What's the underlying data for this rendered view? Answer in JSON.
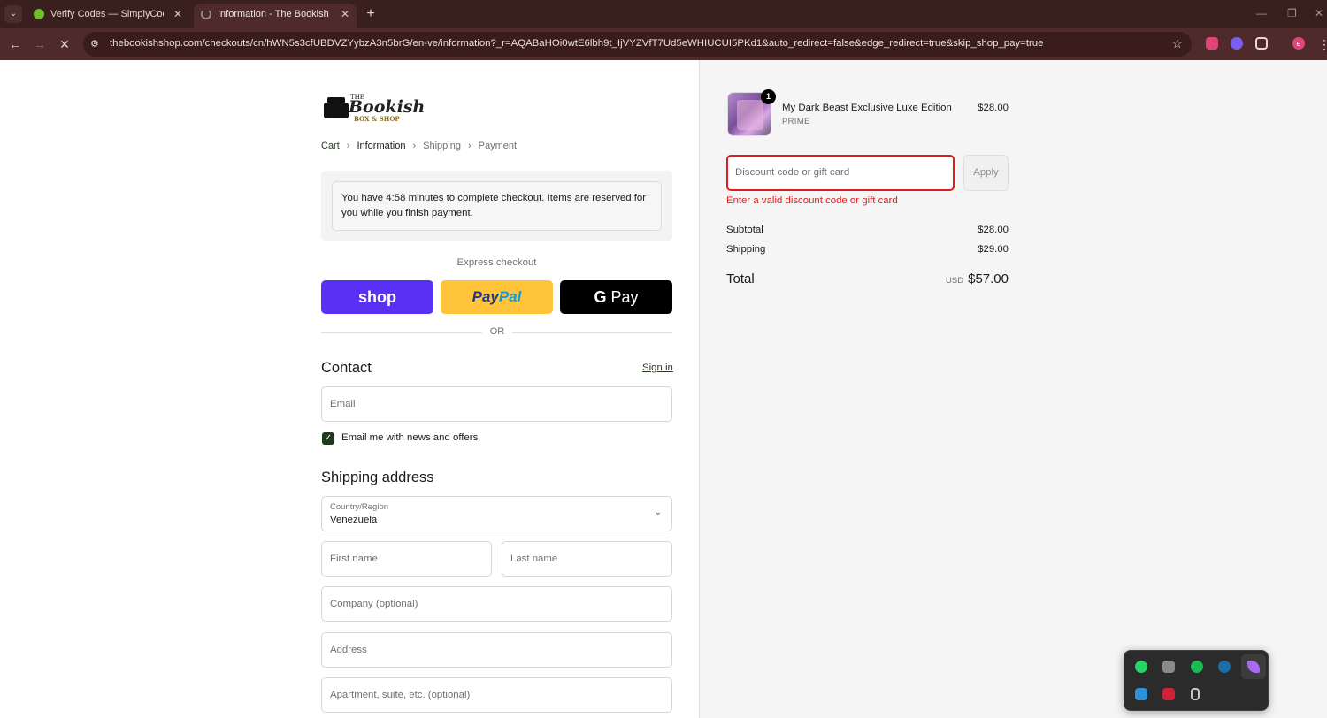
{
  "browser": {
    "tabs": [
      {
        "title": "Verify Codes — SimplyCodes",
        "active": false,
        "favicon_color": "#6fbf2a"
      },
      {
        "title": "Information - The Bookish Shop",
        "active": true,
        "favicon_color": "#9a8a8a"
      }
    ],
    "url": "thebookishshop.com/checkouts/cn/hWN5s3cfUBDVZYybzA3n5brG/en-ve/information?_r=AQABaHOi0wtE6lbh9t_IjVYZVfT7Ud5eWHIUCUI5PKd1&auto_redirect=false&edge_redirect=true&skip_shop_pay=true",
    "extensions": [
      {
        "name": "shield-extension-icon",
        "color": "#e0457a"
      },
      {
        "name": "purple-extension-icon",
        "color": "#7b5cf5"
      },
      {
        "name": "puzzle-extension-icon",
        "color": "#4e2a2a"
      },
      {
        "name": "profile-avatar",
        "color": "#e0457a",
        "letter": "e"
      }
    ]
  },
  "logo": {
    "the": "THE",
    "word": "Bookish",
    "sub": "BOX & SHOP"
  },
  "breadcrumb": {
    "cart": "Cart",
    "information": "Information",
    "shipping": "Shipping",
    "payment": "Payment"
  },
  "timer_notice": "You have 4:58 minutes to complete checkout. Items are reserved for you while you finish payment.",
  "express": {
    "label": "Express checkout",
    "shop": "shop",
    "paypal_a": "Pay",
    "paypal_b": "Pal",
    "gpay_g": "G",
    "gpay_text": "Pay"
  },
  "or_text": "OR",
  "contact": {
    "heading": "Contact",
    "sign_in": "Sign in",
    "email_placeholder": "Email",
    "newsletter_label": "Email me with news and offers",
    "newsletter_checked": true
  },
  "shipping": {
    "heading": "Shipping address",
    "country_label": "Country/Region",
    "country_value": "Venezuela",
    "first_name": "First name",
    "last_name": "Last name",
    "company": "Company (optional)",
    "address": "Address",
    "apartment": "Apartment, suite, etc. (optional)"
  },
  "order": {
    "item": {
      "name": "My Dark Beast Exclusive Luxe Edition",
      "variant": "PRIME",
      "price": "$28.00",
      "quantity": "1"
    },
    "discount_placeholder": "Discount code or gift card",
    "apply_label": "Apply",
    "error_text": "Enter a valid discount code or gift card",
    "subtotal_label": "Subtotal",
    "subtotal": "$28.00",
    "shipping_label": "Shipping",
    "shipping": "$29.00",
    "total_label": "Total",
    "currency": "USD",
    "total": "$57.00"
  },
  "tray": [
    {
      "name": "whatsapp-tray-icon",
      "color": "#25d366"
    },
    {
      "name": "notes-tray-icon",
      "color": "#8a8a8a"
    },
    {
      "name": "spotify-tray-icon",
      "color": "#1db954"
    },
    {
      "name": "steam-tray-icon",
      "color": "#1b6fa8"
    },
    {
      "name": "feather-tray-icon",
      "color": "#a86bf0"
    },
    {
      "name": "security-tray-icon",
      "color": "#2f8fd8"
    },
    {
      "name": "amd-tray-icon",
      "color": "#d0213a"
    },
    {
      "name": "usb-tray-icon",
      "color": "#c8c8c8"
    }
  ]
}
